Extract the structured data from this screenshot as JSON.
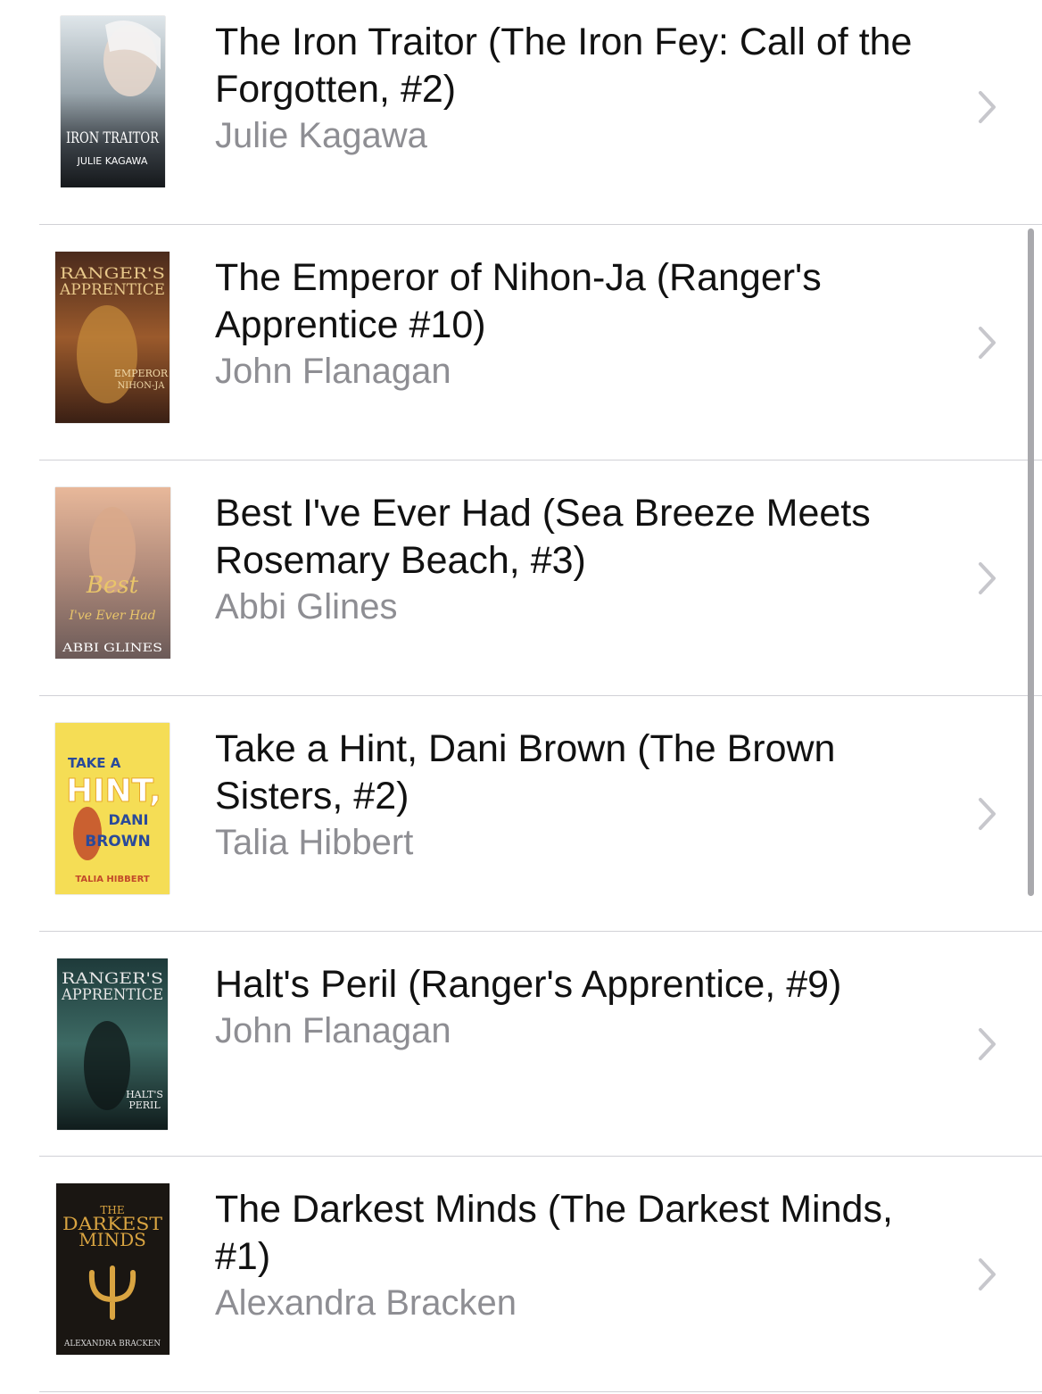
{
  "books": [
    {
      "title": "The Iron Traitor (The Iron Fey: Call of the Forgotten, #2)",
      "author": "Julie Kagawa",
      "cover": {
        "icon": "book-cover-iron-traitor",
        "text_top": "IRON TRAITOR",
        "text_bottom": "JULIE KAGAWA"
      }
    },
    {
      "title": "The Emperor of Nihon-Ja (Ranger's Apprentice #10)",
      "author": "John Flanagan",
      "cover": {
        "icon": "book-cover-emperor-of-nihon-ja",
        "text_top": "RANGER'S APPRENTICE",
        "text_bottom": "EMPEROR NIHON-JA"
      }
    },
    {
      "title": "Best I've Ever Had (Sea Breeze Meets Rosemary Beach, #3)",
      "author": "Abbi Glines",
      "cover": {
        "icon": "book-cover-best-ive-ever-had",
        "text_top": "Best I've Ever Had",
        "text_bottom": "ABBI GLINES"
      }
    },
    {
      "title": "Take a Hint, Dani Brown (The Brown Sisters, #2)",
      "author": "Talia Hibbert",
      "cover": {
        "icon": "book-cover-take-a-hint-dani-brown",
        "text_top": "TAKE A HINT, DANI BROWN",
        "text_bottom": "TALIA HIBBERT"
      }
    },
    {
      "title": "Halt's Peril (Ranger's Apprentice, #9)",
      "author": "John Flanagan",
      "cover": {
        "icon": "book-cover-halts-peril",
        "text_top": "RANGER'S APPRENTICE",
        "text_bottom": "HALT'S PERIL"
      }
    },
    {
      "title": "The Darkest Minds (The Darkest Minds, #1)",
      "author": "Alexandra Bracken",
      "cover": {
        "icon": "book-cover-darkest-minds",
        "text_top": "THE DARKEST MINDS",
        "text_bottom": "ALEXANDRA BRACKEN"
      }
    }
  ],
  "colors": {
    "title": "#111111",
    "author": "#8e8e93",
    "separator": "#d1d1d6",
    "chevron": "#c7c7cc",
    "scrollbar": "#a9a9ad"
  },
  "icons": {
    "chevron": "chevron-right-icon"
  }
}
